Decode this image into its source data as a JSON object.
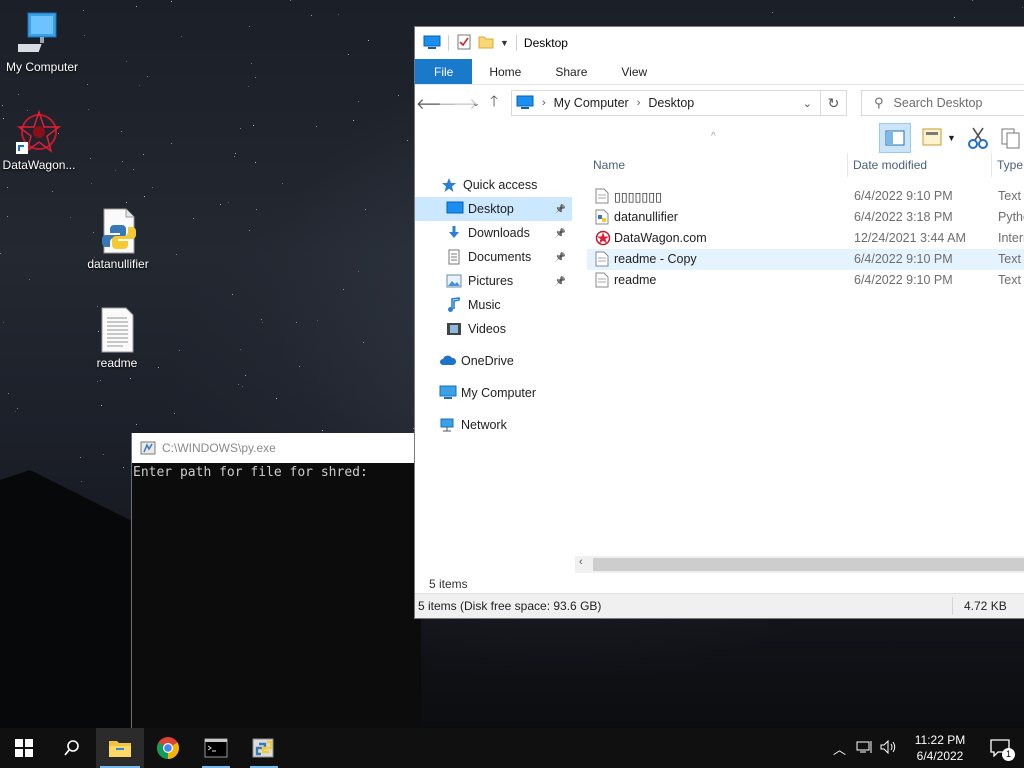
{
  "desktop": {
    "icons": [
      {
        "label": "My Computer"
      },
      {
        "label": "DataWagon..."
      },
      {
        "label": "datanullifier"
      },
      {
        "label": "readme"
      }
    ]
  },
  "console": {
    "title": "C:\\WINDOWS\\py.exe",
    "prompt": "Enter path for file for shred:"
  },
  "explorer": {
    "title": "Desktop",
    "tabs": [
      "File",
      "Home",
      "Share",
      "View"
    ],
    "breadcrumb": [
      "My Computer",
      "Desktop"
    ],
    "search_placeholder": "Search Desktop",
    "nav": [
      {
        "label": "Quick access",
        "icon": "star-icon"
      },
      {
        "label": "Desktop",
        "icon": "desktop-folder-icon",
        "pinned": true,
        "selected": true
      },
      {
        "label": "Downloads",
        "icon": "download-folder-icon",
        "pinned": true
      },
      {
        "label": "Documents",
        "icon": "documents-folder-icon",
        "pinned": true
      },
      {
        "label": "Pictures",
        "icon": "pictures-folder-icon",
        "pinned": true
      },
      {
        "label": "Music",
        "icon": "music-icon"
      },
      {
        "label": "Videos",
        "icon": "videos-icon"
      },
      {
        "label": "OneDrive",
        "icon": "cloud-icon"
      },
      {
        "label": "My Computer",
        "icon": "computer-icon"
      },
      {
        "label": "Network",
        "icon": "network-icon"
      }
    ],
    "columns": [
      "Name",
      "Date modified",
      "Type"
    ],
    "files": [
      {
        "name": "▯▯▯▯▯▯▯",
        "date": "6/4/2022 9:10 PM",
        "type": "Text D"
      },
      {
        "name": "datanullifier",
        "date": "6/4/2022 3:18 PM",
        "type": "Pytho"
      },
      {
        "name": "DataWagon.com",
        "date": "12/24/2021 3:44 AM",
        "type": "Intern"
      },
      {
        "name": "readme - Copy",
        "date": "6/4/2022 9:10 PM",
        "type": "Text D"
      },
      {
        "name": "readme",
        "date": "6/4/2022 9:10 PM",
        "type": "Text D"
      }
    ],
    "items_count": "5 items",
    "status_left": "5 items (Disk free space: 93.6 GB)",
    "status_size": "4.72 KB"
  },
  "taskbar": {
    "time": "11:22 PM",
    "date": "6/4/2022",
    "notification_count": "1"
  }
}
